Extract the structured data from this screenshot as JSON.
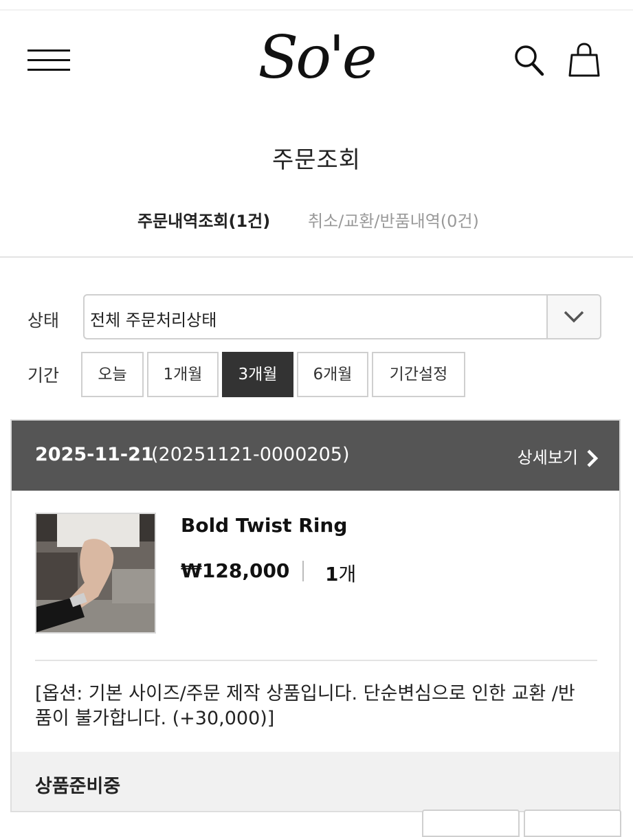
{
  "header": {
    "logo_text": "So'e",
    "menu_icon": "hamburger-menu-icon",
    "search_icon": "search-icon",
    "cart_icon": "shopping-bag-icon"
  },
  "page": {
    "title": "주문조회"
  },
  "tabs": {
    "orders": "주문내역조회(1건)",
    "cancel": "취소/교환/반품내역(0건)"
  },
  "filters": {
    "status_label": "상태",
    "status_value": "전체 주문처리상태",
    "period_label": "기간",
    "periods": [
      "오늘",
      "1개월",
      "3개월",
      "6개월",
      "기간설정"
    ],
    "active_period": "3개월"
  },
  "order": {
    "date": "2025-11-21",
    "order_no": "(20251121-0000205)",
    "detail_label": "상세보기",
    "product_name": "Bold Twist Ring",
    "price": "₩128,000",
    "quantity": "1",
    "quantity_unit": "개",
    "option_text": "[옵션: 기본 사이즈/주문 제작 상품입니다. 단순변심으로 인한 교환 /반품이 불가합니다. (+30,000)]",
    "status": "상품준비중"
  },
  "colors": {
    "order_header_bg": "#555555",
    "active_period_bg": "#333333",
    "status_bar_bg": "#f1f1f1"
  }
}
